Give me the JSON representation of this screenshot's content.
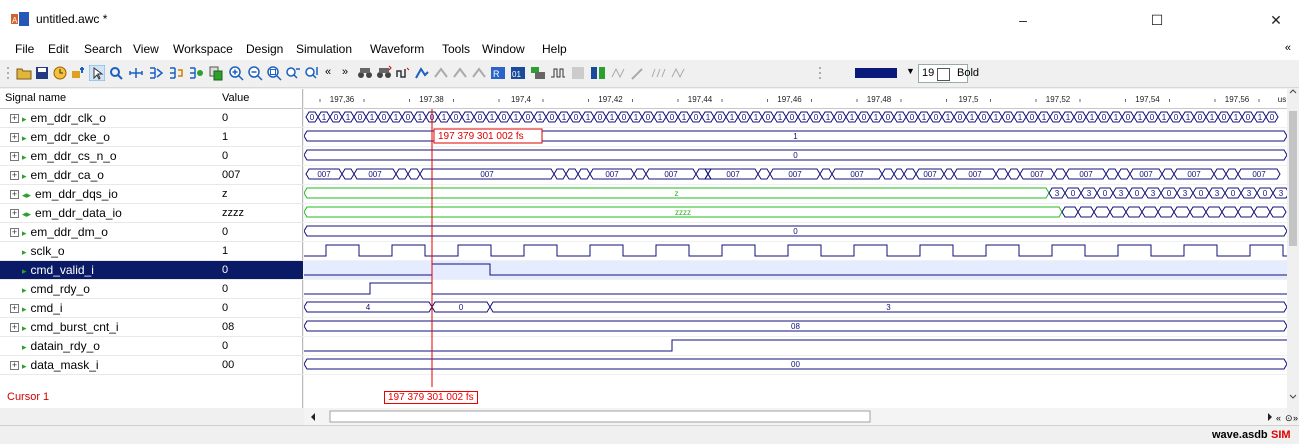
{
  "window": {
    "title": "untitled.awc *",
    "minimize": "–",
    "maximize": "☐",
    "close": "✕"
  },
  "menu": [
    "File",
    "Edit",
    "Search",
    "View",
    "Workspace",
    "Design",
    "Simulation",
    "Waveform",
    "Tools",
    "Window",
    "Help"
  ],
  "menu_chevron": "«",
  "toolbar": {
    "font_size": "19",
    "bold_label": "Bold",
    "color": "#0a1a7a"
  },
  "columns": {
    "name": "Signal name",
    "value": "Value"
  },
  "signals": [
    {
      "name": "em_ddr_clk_o",
      "value": "0",
      "expand": true,
      "arrow": "out"
    },
    {
      "name": "em_ddr_cke_o",
      "value": "1",
      "expand": true,
      "arrow": "out"
    },
    {
      "name": "em_ddr_cs_n_o",
      "value": "0",
      "expand": true,
      "arrow": "out"
    },
    {
      "name": "em_ddr_ca_o",
      "value": "007",
      "expand": true,
      "arrow": "out"
    },
    {
      "name": "em_ddr_dqs_io",
      "value": "z",
      "expand": true,
      "arrow": "inout"
    },
    {
      "name": "em_ddr_data_io",
      "value": "zzzz",
      "expand": true,
      "arrow": "inout"
    },
    {
      "name": "em_ddr_dm_o",
      "value": "0",
      "expand": true,
      "arrow": "out"
    },
    {
      "name": "sclk_o",
      "value": "1",
      "expand": false,
      "arrow": "out"
    },
    {
      "name": "cmd_valid_i",
      "value": "0",
      "expand": false,
      "arrow": "in"
    },
    {
      "name": "cmd_rdy_o",
      "value": "0",
      "expand": false,
      "arrow": "out"
    },
    {
      "name": "cmd_i",
      "value": "0",
      "expand": true,
      "arrow": "in"
    },
    {
      "name": "cmd_burst_cnt_i",
      "value": "08",
      "expand": true,
      "arrow": "in"
    },
    {
      "name": "datain_rdy_o",
      "value": "0",
      "expand": false,
      "arrow": "out"
    },
    {
      "name": "data_mask_i",
      "value": "00",
      "expand": true,
      "arrow": "in"
    }
  ],
  "selected_index": 8,
  "cursor": {
    "label": "Cursor 1",
    "time": "197 379 301 002 fs"
  },
  "timescale": {
    "ticks": [
      "197,36",
      "197,38",
      "197,4",
      "197,42",
      "197,44",
      "197,46",
      "197,48",
      "197,5",
      "197,52",
      "197,54",
      "197,56"
    ],
    "unit": "us"
  },
  "wave_labels": {
    "cke": "1",
    "cs_n": "0",
    "ca": "007",
    "dqs": "z",
    "dqs_toggle": [
      "3",
      "0"
    ],
    "data": "zzzz",
    "dm": "0",
    "cmd_before": "4",
    "cmd_mid": "0",
    "cmd_after": "3",
    "burst": "08",
    "mask": "00"
  },
  "status": {
    "file": "wave.asdb",
    "mode": "SIM"
  },
  "colors": {
    "wave": "#10107a",
    "selected": "#0a1a66",
    "cursor": "#e00000",
    "highz": "#22bb22"
  }
}
